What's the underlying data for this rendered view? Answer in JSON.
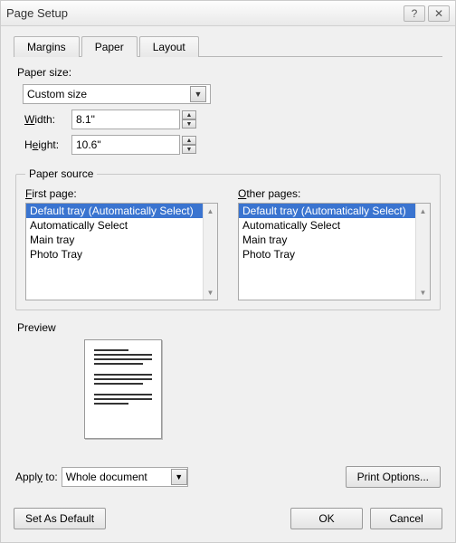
{
  "window": {
    "title": "Page Setup"
  },
  "tabs": {
    "margins": "Margins",
    "paper": "Paper",
    "layout": "Layout"
  },
  "paper_size": {
    "label": "Paper size:",
    "selected": "Custom size",
    "width_label": "Width:",
    "width_value": "8.1\"",
    "height_label": "Height:",
    "height_value": "10.6\""
  },
  "paper_source": {
    "legend": "Paper source",
    "first_page_label": "First page:",
    "other_pages_label": "Other pages:",
    "options": [
      "Default tray (Automatically Select)",
      "Automatically Select",
      "Main tray",
      "Photo Tray"
    ],
    "first_selected_index": 0,
    "other_selected_index": 0
  },
  "preview": {
    "label": "Preview"
  },
  "apply": {
    "label": "Apply to:",
    "value": "Whole document",
    "print_options": "Print Options..."
  },
  "buttons": {
    "set_default": "Set As Default",
    "ok": "OK",
    "cancel": "Cancel"
  }
}
